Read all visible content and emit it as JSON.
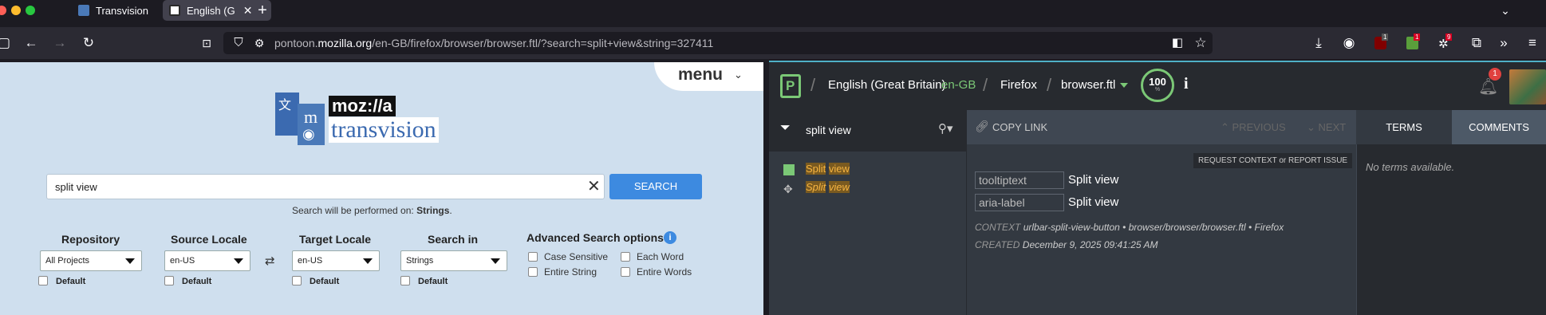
{
  "browser": {
    "tabs": [
      {
        "label": "Transvision",
        "active": false
      },
      {
        "label": "English (G",
        "active": true
      }
    ],
    "url_prefix": "pontoon.",
    "url_domain": "mozilla.org",
    "url_rest": "/en-GB/firefox/browser/browser.ftl/?search=split+view&string=327411",
    "extension_badges": [
      "1",
      "1",
      "9"
    ]
  },
  "transvision": {
    "menu_label": "menu",
    "logo_top": "moz://a",
    "logo_bottom": "transvision",
    "search_value": "split view",
    "search_button": "SEARCH",
    "hint_prefix": "Search will be performed on: ",
    "hint_target": "Strings",
    "hint_suffix": ".",
    "columns": [
      {
        "title": "Repository",
        "selected": "All Projects",
        "default_label": "Default"
      },
      {
        "title": "Source Locale",
        "selected": "en-US",
        "default_label": "Default"
      },
      {
        "title": "Target Locale",
        "selected": "en-US",
        "default_label": "Default"
      },
      {
        "title": "Search in",
        "selected": "Strings",
        "default_label": "Default"
      }
    ],
    "advanced_title": "Advanced Search options",
    "advanced_options": [
      "Case Sensitive",
      "Each Word",
      "Entire String",
      "Entire Words"
    ]
  },
  "pontoon": {
    "locale_name": "English (Great Britain)",
    "locale_code": "en-GB",
    "project": "Firefox",
    "resource": "browser.ftl",
    "progress_value": "100",
    "progress_unit": "%",
    "notification_count": "1",
    "search_value": "split view",
    "strings": [
      {
        "word1": "Split",
        "word2": "view",
        "italic": false
      },
      {
        "word1": "Split",
        "word2": "view",
        "italic": true
      }
    ],
    "copy_link": "COPY LINK",
    "previous": "PREVIOUS",
    "next": "NEXT",
    "request_context": "REQUEST CONTEXT or REPORT ISSUE",
    "attributes": [
      {
        "key": "tooltiptext",
        "value": "Split view"
      },
      {
        "key": "aria-label",
        "value": "Split view"
      }
    ],
    "context_label": "CONTEXT",
    "context_value": "urlbar-split-view-button • browser/browser/browser.ftl • Firefox",
    "created_label": "CREATED",
    "created_value": "December 9, 2025 09:41:25 AM",
    "tabs": {
      "terms": "TERMS",
      "comments": "COMMENTS"
    },
    "no_terms": "No terms available."
  },
  "colors": {
    "transvision_bg": "#cfdfee",
    "search_button": "#3d8ae0",
    "pontoon_bg": "#272a2f",
    "pontoon_accent": "#7bc876",
    "match_highlight": "#f5b340"
  }
}
